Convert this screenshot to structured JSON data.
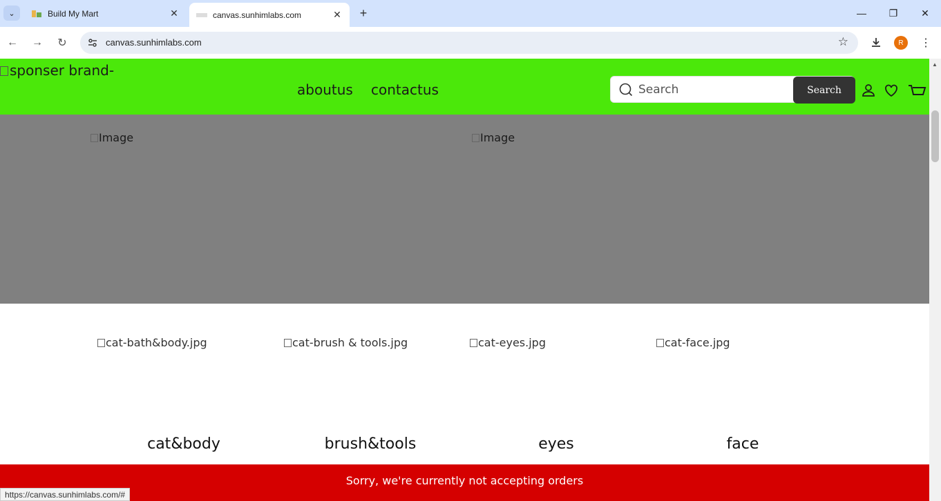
{
  "browser": {
    "tabs": [
      {
        "title": "Build My Mart",
        "active": false
      },
      {
        "title": "canvas.sunhimlabs.com",
        "active": true
      }
    ],
    "new_tab": "+",
    "url": "canvas.sunhimlabs.com",
    "profile_initial": "R",
    "status_url": "https://canvas.sunhimlabs.com/#"
  },
  "header": {
    "brand_alt": "sponser brand-",
    "nav": [
      "aboutus",
      "contactus"
    ],
    "search": {
      "placeholder": "Search",
      "button": "Search"
    },
    "bg_color": "#4be80a"
  },
  "hero": {
    "images": [
      "Image",
      "Image"
    ],
    "bg_color": "#808080"
  },
  "categories": [
    {
      "image_alt": "cat-bath&body.jpg",
      "name": "cat&body"
    },
    {
      "image_alt": "cat-brush & tools.jpg",
      "name": "brush&tools"
    },
    {
      "image_alt": "cat-eyes.jpg",
      "name": "eyes"
    },
    {
      "image_alt": "cat-face.jpg",
      "name": "face"
    }
  ],
  "notice": {
    "text": "Sorry, we're currently not accepting orders",
    "bg_color": "#d50000"
  }
}
